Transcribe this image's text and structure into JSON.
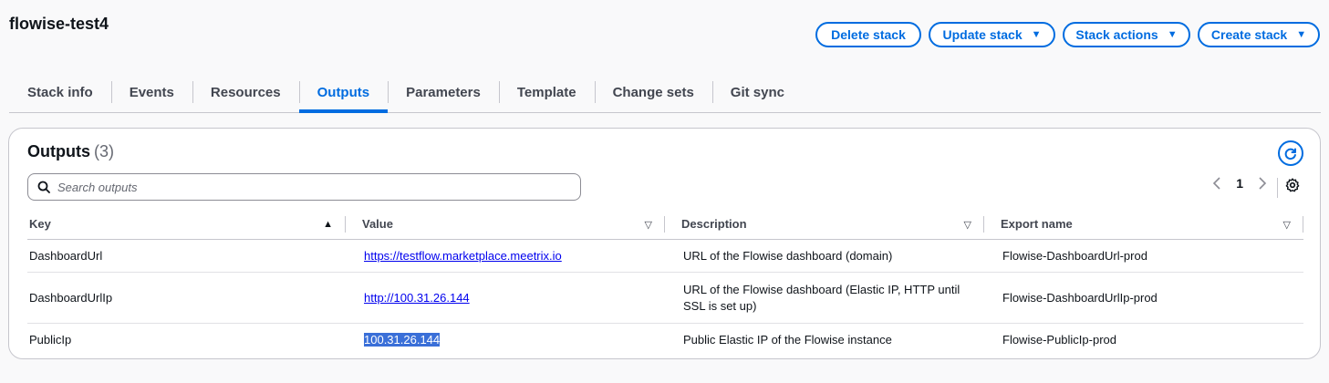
{
  "stack": {
    "title": "flowise-test4"
  },
  "actions": {
    "delete_label": "Delete stack",
    "update_label": "Update stack",
    "stack_actions_label": "Stack actions",
    "create_label": "Create stack"
  },
  "tabs": [
    {
      "label": "Stack info"
    },
    {
      "label": "Events"
    },
    {
      "label": "Resources"
    },
    {
      "label": "Outputs",
      "active": true
    },
    {
      "label": "Parameters"
    },
    {
      "label": "Template"
    },
    {
      "label": "Change sets"
    },
    {
      "label": "Git sync"
    }
  ],
  "outputs": {
    "title": "Outputs",
    "count": "(3)",
    "search_placeholder": "Search outputs",
    "page": "1",
    "columns": {
      "key": "Key",
      "value": "Value",
      "description": "Description",
      "export_name": "Export name"
    },
    "rows": [
      {
        "key": "DashboardUrl",
        "value": "https://testflow.marketplace.meetrix.io",
        "description": "URL of the Flowise dashboard (domain)",
        "export_name": "Flowise-DashboardUrl-prod"
      },
      {
        "key": "DashboardUrlIp",
        "value": "http://100.31.26.144",
        "description": "URL of the Flowise dashboard (Elastic IP, HTTP until SSL is set up)",
        "export_name": "Flowise-DashboardUrlIp-prod"
      },
      {
        "key": "PublicIp",
        "value": "100.31.26.144",
        "description": "Public Elastic IP of the Flowise instance",
        "export_name": "Flowise-PublicIp-prod"
      }
    ]
  },
  "icons": {
    "caret": "caret-down-icon",
    "refresh": "refresh-icon",
    "search": "search-icon",
    "settings": "gear-icon",
    "prev": "chevron-left-icon",
    "next": "chevron-right-icon"
  },
  "colors": {
    "accent": "#006ce0",
    "link": "#0000ee",
    "selection": "#3a6fd8"
  }
}
